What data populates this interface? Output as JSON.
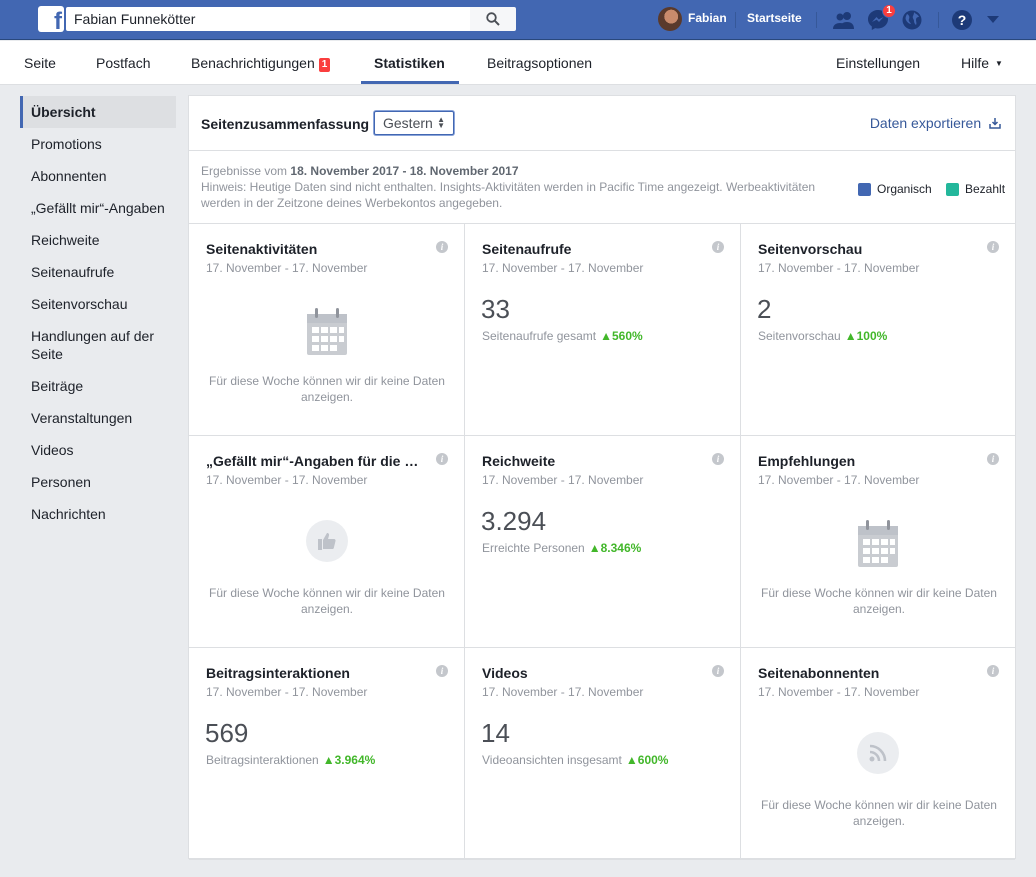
{
  "topbar": {
    "search_value": "Fabian Funnekötter",
    "user_name": "Fabian",
    "home_label": "Startseite",
    "messages_badge": "1",
    "icons": [
      "facebook-logo-icon",
      "search-icon",
      "friends-icon",
      "messenger-icon",
      "globe-icon",
      "help-icon",
      "caret-down-icon"
    ]
  },
  "pagenav": {
    "items": [
      "Seite",
      "Postfach",
      "Benachrichtigungen",
      "Statistiken",
      "Beitragsoptionen"
    ],
    "notifications_badge": "1",
    "active": "Statistiken",
    "settings_label": "Einstellungen",
    "help_label": "Hilfe"
  },
  "sidebar": {
    "items": [
      "Übersicht",
      "Promotions",
      "Abonnenten",
      "„Gefällt mir“-Angaben",
      "Reichweite",
      "Seitenaufrufe",
      "Seitenvorschau",
      "Handlungen auf der Seite",
      "Beiträge",
      "Veranstaltungen",
      "Videos",
      "Personen",
      "Nachrichten"
    ],
    "active": "Übersicht"
  },
  "summary": {
    "title": "Seitenzusammenfassung",
    "range_value": "Gestern",
    "export_label": "Daten exportieren",
    "results_prefix": "Ergebnisse vom",
    "results_range": "18. November 2017 - 18. November 2017",
    "hint": "Hinweis: Heutige Daten sind nicht enthalten. Insights-Aktivitäten werden in Pacific Time angezeigt. Werbeaktivitäten werden in der Zeitzone deines Werbekontos angegeben.",
    "legend": [
      {
        "label": "Organisch",
        "color": "#4267b2"
      },
      {
        "label": "Bezahlt",
        "color": "#23b79b"
      }
    ]
  },
  "cards": [
    {
      "title": "Seitenaktivitäten",
      "date": "17. November - 17. November",
      "empty": "Für diese Woche können wir dir keine Daten anzeigen.",
      "icon": "calendar-icon"
    },
    {
      "title": "Seitenaufrufe",
      "date": "17. November - 17. November",
      "value": "33",
      "label": "Seitenaufrufe gesamt",
      "delta": "560%"
    },
    {
      "title": "Seitenvorschau",
      "date": "17. November - 17. November",
      "value": "2",
      "label": "Seitenvorschau",
      "delta": "100%"
    },
    {
      "title": "„Gefällt mir“-Angaben für die Seite",
      "date": "17. November - 17. November",
      "empty": "Für diese Woche können wir dir keine Daten anzeigen.",
      "icon": "thumbs-up-icon"
    },
    {
      "title": "Reichweite",
      "date": "17. November - 17. November",
      "value": "3.294",
      "label": "Erreichte Personen",
      "delta": "8.346%"
    },
    {
      "title": "Empfehlungen",
      "date": "17. November - 17. November",
      "empty": "Für diese Woche können wir dir keine Daten anzeigen.",
      "icon": "calendar-icon"
    },
    {
      "title": "Beitragsinteraktionen",
      "date": "17. November - 17. November",
      "value": "569",
      "label": "Beitragsinteraktionen",
      "delta": "3.964%"
    },
    {
      "title": "Videos",
      "date": "17. November - 17. November",
      "value": "14",
      "label": "Videoansichten insgesamt",
      "delta": "600%"
    },
    {
      "title": "Seitenabonnenten",
      "date": "17. November - 17. November",
      "empty": "Für diese Woche können wir dir keine Daten anzeigen.",
      "icon": "rss-icon"
    }
  ]
}
